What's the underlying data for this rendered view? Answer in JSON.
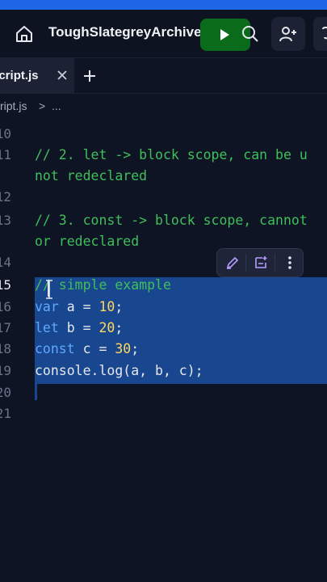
{
  "header": {
    "repl_name": "ToughSlategreyArchives",
    "icons": [
      "home-icon",
      "play-icon",
      "search-icon",
      "add-user-icon",
      "more-icon"
    ]
  },
  "tabs": {
    "active_label": "script.js",
    "close_glyph": "×",
    "new_tab_glyph": "+"
  },
  "breadcrumb": {
    "file": "script.js",
    "separator": ">",
    "more": "..."
  },
  "editor": {
    "lines": [
      {
        "num": "10",
        "text": ""
      },
      {
        "num": "11",
        "text": "// 2. let -> block scope, can be u"
      },
      {
        "num": "",
        "text": "not redeclared"
      },
      {
        "num": "12",
        "text": ""
      },
      {
        "num": "13",
        "text": "// 3. const -> block scope, cannot"
      },
      {
        "num": "",
        "text": "or redeclared"
      },
      {
        "num": "14",
        "text": ""
      },
      {
        "num": "15",
        "text": "// simple example"
      },
      {
        "num": "16",
        "text": "var a = 10;"
      },
      {
        "num": "17",
        "text": "let b = 20;"
      },
      {
        "num": "18",
        "text": "const c = 30;"
      },
      {
        "num": "19",
        "text": "console.log(a, b, c);"
      },
      {
        "num": "20",
        "text": ""
      },
      {
        "num": "21",
        "text": ""
      }
    ]
  },
  "floating_toolbar": {
    "icons": [
      "edit-ai-icon",
      "explain-icon",
      "more-vertical-icon"
    ]
  },
  "colors": {
    "accent": "#1f66e6",
    "run": "#0a6b1a",
    "comment": "#3fbf5a",
    "keyword": "#5fa8ff",
    "number": "#ffd75e",
    "selection": "#19478f"
  }
}
